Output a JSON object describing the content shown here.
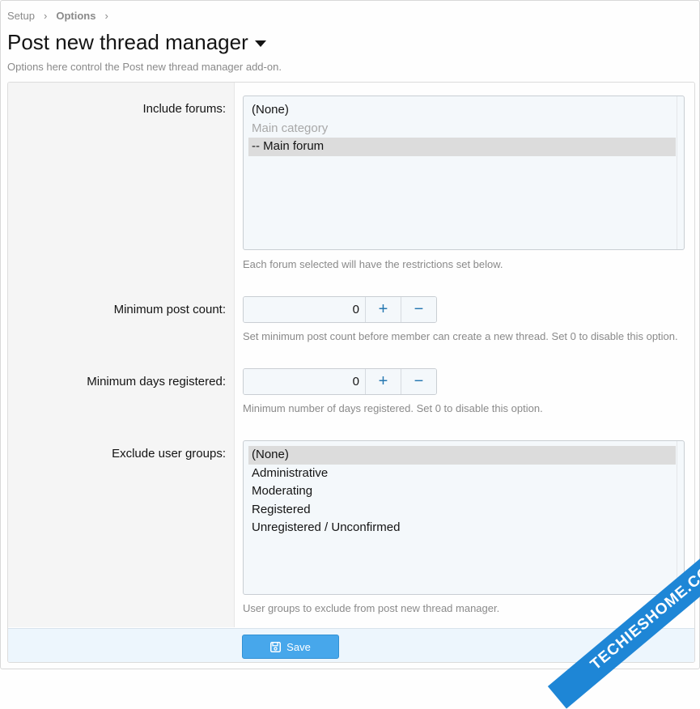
{
  "breadcrumb": {
    "items": [
      "Setup",
      "Options"
    ]
  },
  "page": {
    "title": "Post new thread manager",
    "description": "Options here control the Post new thread manager add-on."
  },
  "include_forums": {
    "label": "Include forums:",
    "options": [
      {
        "label": "(None)",
        "selected": false,
        "disabled": false
      },
      {
        "label": "Main category",
        "selected": false,
        "disabled": true
      },
      {
        "label": "-- Main forum",
        "selected": true,
        "disabled": false
      }
    ],
    "explain": "Each forum selected will have the restrictions set below."
  },
  "min_post_count": {
    "label": "Minimum post count:",
    "value": "0",
    "explain": "Set minimum post count before member can create a new thread. Set 0 to disable this option."
  },
  "min_days_registered": {
    "label": "Minimum days registered:",
    "value": "0",
    "explain": "Minimum number of days registered. Set 0 to disable this option."
  },
  "exclude_user_groups": {
    "label": "Exclude user groups:",
    "options": [
      {
        "label": "(None)",
        "selected": true,
        "disabled": false
      },
      {
        "label": "Administrative",
        "selected": false,
        "disabled": false
      },
      {
        "label": "Moderating",
        "selected": false,
        "disabled": false
      },
      {
        "label": "Registered",
        "selected": false,
        "disabled": false
      },
      {
        "label": "Unregistered / Unconfirmed",
        "selected": false,
        "disabled": false
      }
    ],
    "explain": "User groups to exclude from post new thread manager."
  },
  "stepper": {
    "plus": "+",
    "minus": "−"
  },
  "footer": {
    "save_label": "Save"
  },
  "watermark": {
    "text": "TECHIESHOME.COM"
  },
  "colors": {
    "accent": "#47a7eb",
    "stepper_icon": "#2577b1",
    "muted_text": "#8a8a8a",
    "selected_option": "#dcdcdc"
  },
  "icons": {
    "breadcrumb_separator": "chevron-right-icon",
    "title_menu": "caret-down-icon",
    "save": "floppy-disk-icon"
  }
}
